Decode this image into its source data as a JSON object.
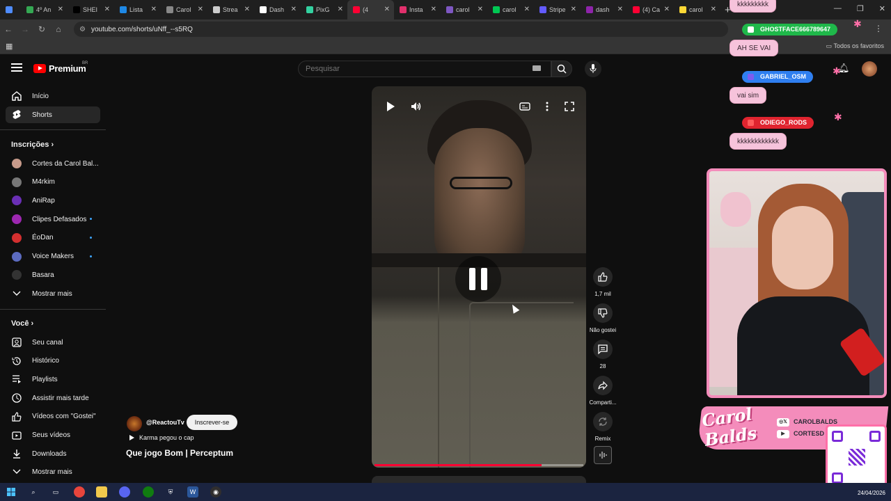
{
  "browser": {
    "tabs": [
      {
        "label": "",
        "color": "#4f8cff"
      },
      {
        "label": "4º An",
        "color": "#34a853"
      },
      {
        "label": "SHEI",
        "color": "#000000"
      },
      {
        "label": "Lista",
        "color": "#1e88e5"
      },
      {
        "label": "Carol",
        "color": "#888888"
      },
      {
        "label": "Strea",
        "color": "#cccccc"
      },
      {
        "label": "Dash",
        "color": "#ffffff"
      },
      {
        "label": "PixG",
        "color": "#33d1a0"
      },
      {
        "label": "(4",
        "color": "#ff0033"
      },
      {
        "label": "Insta",
        "color": "#e1306c"
      },
      {
        "label": "carol",
        "color": "#7e57c2"
      },
      {
        "label": "carol",
        "color": "#00c853"
      },
      {
        "label": "Stripe",
        "color": "#635bff"
      },
      {
        "label": "dash",
        "color": "#8e24aa"
      },
      {
        "label": "(4) Ca",
        "color": "#ff0033"
      },
      {
        "label": "carol",
        "color": "#fdd835"
      }
    ],
    "active_tab_index": 8,
    "url": "youtube.com/shorts/uNff_--s5RQ",
    "all_bookmarks": "Todos os favoritos"
  },
  "youtube": {
    "logo_text": "Premium",
    "logo_region": "BR",
    "search_placeholder": "Pesquisar",
    "sidebar": {
      "main": [
        {
          "label": "Início",
          "icon": "home-icon"
        },
        {
          "label": "Shorts",
          "icon": "shorts-icon"
        }
      ],
      "subscriptions_title": "Inscrições",
      "subscriptions": [
        {
          "label": "Cortes da Carol Bal...",
          "avatar_color": "#c79a8a",
          "new": false
        },
        {
          "label": "M4rkim",
          "avatar_color": "#777777",
          "new": false
        },
        {
          "label": "AniRap",
          "avatar_color": "#6a2fb5",
          "new": false
        },
        {
          "label": "Clipes Defasados",
          "avatar_color": "#9c27b0",
          "new": true
        },
        {
          "label": "ÉoDan",
          "avatar_color": "#d32f2f",
          "new": true
        },
        {
          "label": "Voice Makers",
          "avatar_color": "#5c6bc0",
          "new": true
        },
        {
          "label": "Basara",
          "avatar_color": "#333333",
          "new": false
        }
      ],
      "show_more": "Mostrar mais",
      "you_title": "Você",
      "you": [
        {
          "label": "Seu canal",
          "icon": "channel-icon"
        },
        {
          "label": "Histórico",
          "icon": "history-icon"
        },
        {
          "label": "Playlists",
          "icon": "playlists-icon"
        },
        {
          "label": "Assistir mais tarde",
          "icon": "watch-later-icon"
        },
        {
          "label": "Vídeos com \"Gostei\"",
          "icon": "like-icon"
        },
        {
          "label": "Seus vídeos",
          "icon": "your-videos-icon"
        },
        {
          "label": "Downloads",
          "icon": "download-icon"
        }
      ],
      "show_more_2": "Mostrar mais"
    },
    "short": {
      "progress": 0.8,
      "actions": {
        "likes": "1,7 mil",
        "dislike": "Não gostei",
        "comments": "28",
        "share": "Comparti...",
        "remix": "Remix"
      },
      "channel": "@ReactouTv",
      "subscribe": "Inscrever-se",
      "music": "Karma pegou o cap",
      "title": "Que jogo Bom | Perceptum"
    }
  },
  "overlay": {
    "chat": [
      {
        "user": "",
        "message": "kkkkkkkkk"
      },
      {
        "user": "GHOSTFACE666789647",
        "message": "AH SE VAI",
        "color": "#1fb84a"
      },
      {
        "user": "GABRIEL_OSM",
        "message": "vai sim",
        "color": "#2f7ff0"
      },
      {
        "user": "ODIEGO_RODS",
        "message": "kkkkkkkkkkkk",
        "color": "#e0242f"
      }
    ],
    "brand": "Carol\nBalds",
    "socials": [
      "CAROLBALDS",
      "CORTESD"
    ]
  },
  "taskbar": {
    "date": "24/04/2026"
  }
}
